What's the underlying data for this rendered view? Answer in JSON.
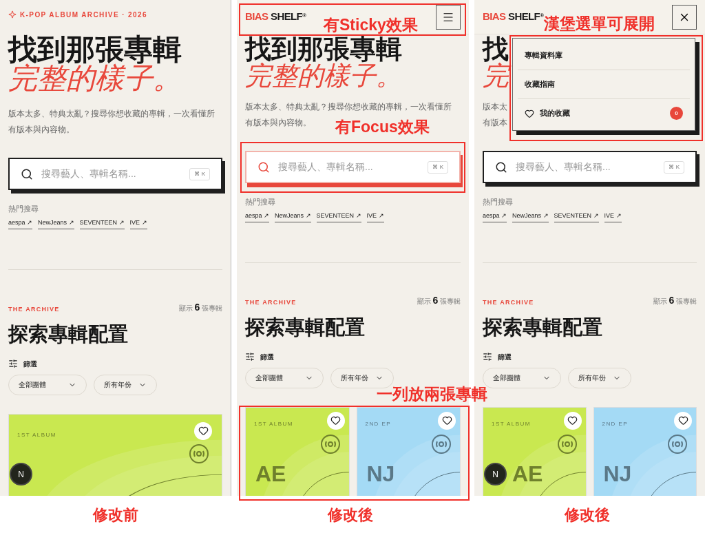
{
  "panels": [
    {
      "caption": "修改前",
      "kicker": "K-POP ALBUM ARCHIVE · 2026",
      "hero": {
        "title": "找到那張專輯",
        "subtitle": "完整的樣子。",
        "intro": [
          "版本太多、特典太亂？搜尋你想收藏的專輯，一次看懂所",
          "有版本與內容物。"
        ]
      },
      "search": {
        "placeholder": "搜尋藝人、專輯名稱...",
        "shortcut": "⌘ K",
        "focused": false
      },
      "popular": {
        "label": "熱門搜尋",
        "tags": [
          "aespa ↗",
          "NewJeans ↗",
          "SEVENTEEN ↗",
          "IVE ↗"
        ]
      },
      "archive": {
        "eyebrow": "THE ARCHIVE",
        "count": "顯示 **6** 張專輯",
        "title": "探索專輯配置",
        "filter_label": "篩選",
        "filters": [
          "全部團體",
          "所有年份"
        ]
      },
      "albums": [
        {
          "label": "1ST ALBUM",
          "color": "#c9e850"
        }
      ],
      "dev_badge": "N"
    },
    {
      "caption": "修改後",
      "header": {
        "logo_accent": "BIAS",
        "logo": "SHELF",
        "mark": "®",
        "menu_open": false
      },
      "hero": {
        "title": "找到那張專輯",
        "subtitle": "完整的樣子。",
        "intro": [
          "版本太多、特典太亂？搜尋你想收藏的專輯，一次看懂所",
          "有版本與內容物。"
        ]
      },
      "search": {
        "placeholder": "搜尋藝人、專輯名稱...",
        "shortcut": "⌘ K",
        "focused": true
      },
      "popular": {
        "label": "熱門搜尋",
        "tags": [
          "aespa ↗",
          "NewJeans ↗",
          "SEVENTEEN ↗",
          "IVE ↗"
        ]
      },
      "archive": {
        "eyebrow": "THE ARCHIVE",
        "count": "顯示 **6** 張專輯",
        "title": "探索專輯配置",
        "filter_label": "篩選",
        "filters": [
          "全部團體",
          "所有年份"
        ]
      },
      "albums": [
        {
          "label": "1ST ALBUM",
          "cover_text": "AE",
          "color": "#c9e850"
        },
        {
          "label": "2ND EP",
          "cover_text": "NJ",
          "color": "#a4daf5"
        }
      ]
    },
    {
      "caption": "修改後",
      "header": {
        "logo_accent": "BIAS",
        "logo": "SHELF",
        "mark": "®",
        "menu_open": true
      },
      "menu": [
        {
          "kind": "link",
          "label": "專輯資料庫"
        },
        {
          "kind": "link",
          "label": "收藏指南"
        },
        {
          "kind": "favorites",
          "label": "我的收藏",
          "count": "0"
        }
      ],
      "hero": {
        "title": "找",
        "subtitle": "完",
        "intro": [
          "版本太",
          "有版本"
        ]
      },
      "search": {
        "placeholder": "搜尋藝人、專輯名稱...",
        "shortcut": "⌘ K",
        "focused": false
      },
      "popular": {
        "label": "熱門搜尋",
        "tags": [
          "aespa ↗",
          "NewJeans ↗",
          "SEVENTEEN ↗",
          "IVE ↗"
        ]
      },
      "archive": {
        "eyebrow": "THE ARCHIVE",
        "count": "顯示 **6** 張專輯",
        "title": "探索專輯配置",
        "filter_label": "篩選",
        "filters": [
          "全部團體",
          "所有年份"
        ]
      },
      "albums": [
        {
          "label": "1ST ALBUM",
          "cover_text": "AE",
          "color": "#c9e850"
        },
        {
          "label": "2ND EP",
          "cover_text": "NJ",
          "color": "#a4daf5"
        }
      ],
      "dev_badge": "N"
    }
  ],
  "annotations": [
    {
      "kind": "sticky",
      "text": "有Sticky效果"
    },
    {
      "kind": "focus",
      "text": "有Focus效果"
    },
    {
      "kind": "grid",
      "text": "一列放兩張專輯"
    },
    {
      "kind": "menu",
      "text": "漢堡選單可展開"
    }
  ]
}
